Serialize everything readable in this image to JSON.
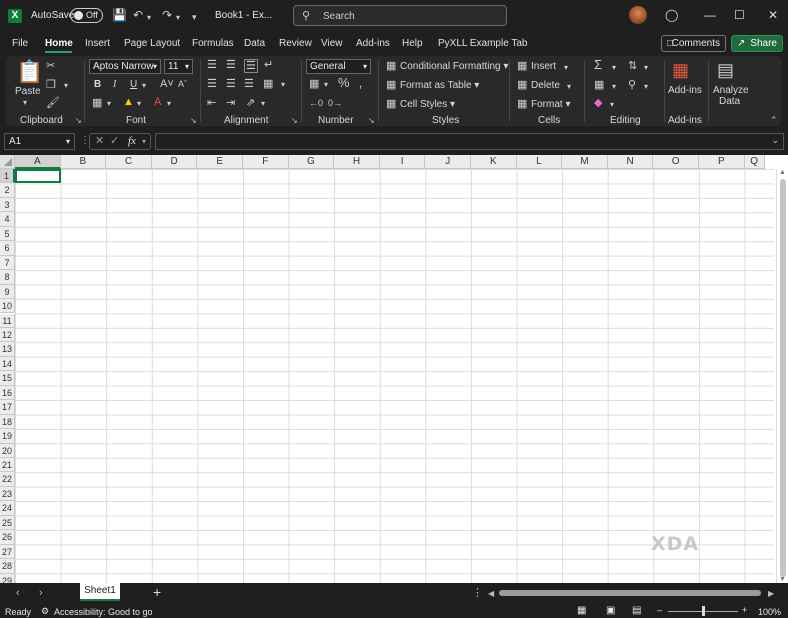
{
  "titlebar": {
    "autosave_label": "AutoSave",
    "autosave_state": "Off",
    "doc_title": "Book1 - Ex...",
    "search_placeholder": "Search"
  },
  "tabs": [
    "File",
    "Home",
    "Insert",
    "Page Layout",
    "Formulas",
    "Data",
    "Review",
    "View",
    "Add-ins",
    "Help",
    "PyXLL Example Tab"
  ],
  "active_tab": "Home",
  "actions": {
    "comments": "Comments",
    "share": "Share"
  },
  "ribbon": {
    "clipboard": {
      "label": "Clipboard",
      "paste": "Paste"
    },
    "font": {
      "label": "Font",
      "name": "Aptos Narrow",
      "size": "11",
      "bold": "B",
      "italic": "I",
      "underline": "U"
    },
    "alignment": {
      "label": "Alignment"
    },
    "number": {
      "label": "Number",
      "format": "General"
    },
    "styles": {
      "label": "Styles",
      "conditional": "Conditional Formatting",
      "format_table": "Format as Table",
      "cell_styles": "Cell Styles"
    },
    "cells": {
      "label": "Cells",
      "insert": "Insert",
      "delete": "Delete",
      "format": "Format"
    },
    "editing": {
      "label": "Editing"
    },
    "addins": {
      "label": "Add-ins",
      "addins_btn": "Add-ins",
      "analyze": "Analyze",
      "analyze2": "Data"
    }
  },
  "formula_bar": {
    "name_box": "A1",
    "fx": "fx",
    "value": ""
  },
  "grid": {
    "columns": [
      "A",
      "B",
      "C",
      "D",
      "E",
      "F",
      "G",
      "H",
      "I",
      "J",
      "K",
      "L",
      "M",
      "N",
      "O",
      "P",
      "Q"
    ],
    "rows": [
      "1",
      "2",
      "3",
      "4",
      "5",
      "6",
      "7",
      "8",
      "9",
      "10",
      "11",
      "12",
      "13",
      "14",
      "15",
      "16",
      "17",
      "18",
      "19",
      "20",
      "21",
      "22",
      "23",
      "24",
      "25",
      "26",
      "27",
      "28",
      "29"
    ],
    "selected_cell": "A1"
  },
  "sheets": [
    "Sheet1"
  ],
  "status": {
    "ready": "Ready",
    "accessibility": "Accessibility: Good to go",
    "zoom": "100%"
  },
  "watermark": "XDA",
  "colors": {
    "accent": "#107c41",
    "share_bg": "#1e6b3c",
    "dark_bg": "#1f1f1f",
    "ribbon_bg": "#292929"
  }
}
